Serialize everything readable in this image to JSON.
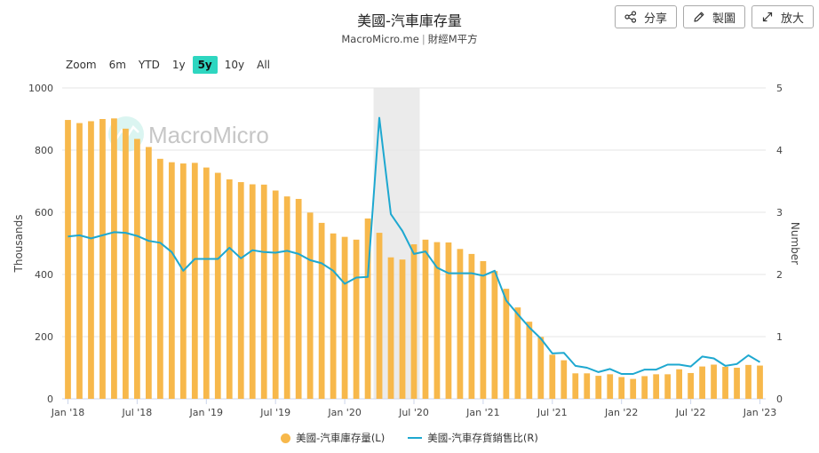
{
  "header": {
    "title": "美國-汽車庫存量",
    "source": "MacroMicro.me",
    "separator": "|",
    "source_cn": "財經M平方"
  },
  "actions": [
    {
      "label": "分享",
      "icon": "share-icon"
    },
    {
      "label": "製圖",
      "icon": "pencil-icon"
    },
    {
      "label": "放大",
      "icon": "expand-icon"
    }
  ],
  "zoom": {
    "label": "Zoom",
    "options": [
      "6m",
      "YTD",
      "1y",
      "5y",
      "10y",
      "All"
    ],
    "selected": "5y"
  },
  "watermark": "MacroMicro",
  "colors": {
    "bars": "#f7b84b",
    "line": "#1ea8d0",
    "accent": "#2ed6c0",
    "highlight": "#e6e6e6"
  },
  "chart_data": {
    "type": "bar",
    "x_ticks": [
      "Jan '18",
      "Jul '18",
      "Jan '19",
      "Jul '19",
      "Jan '20",
      "Jul '20",
      "Jan '21",
      "Jul '21",
      "Jan '22",
      "Jul '22",
      "Jan '23"
    ],
    "y_left": {
      "label": "Thousands",
      "range": [
        0,
        1000
      ],
      "ticks": [
        0,
        200,
        400,
        600,
        800,
        1000
      ]
    },
    "y_right": {
      "label": "Number",
      "range": [
        0,
        5
      ],
      "ticks": [
        0,
        1,
        2,
        3,
        4,
        5
      ]
    },
    "highlight_band": {
      "from_index": 27,
      "to_index": 31
    },
    "series": [
      {
        "name": "美國-汽車庫存量(L)",
        "type": "bar",
        "axis": "left",
        "values": [
          897,
          887,
          893,
          900,
          902,
          869,
          836,
          810,
          772,
          761,
          757,
          759,
          744,
          727,
          706,
          697,
          690,
          689,
          670,
          651,
          643,
          599,
          566,
          532,
          521,
          512,
          580,
          534,
          455,
          448,
          497,
          512,
          504,
          503,
          482,
          466,
          443,
          411,
          354,
          294,
          248,
          199,
          142,
          124,
          82,
          82,
          74,
          79,
          70,
          64,
          73,
          79,
          79,
          95,
          83,
          104,
          110,
          103,
          100,
          109,
          107
        ]
      },
      {
        "name": "美國-汽車存貨銷售比(R)",
        "type": "line",
        "axis": "right",
        "values": [
          2.61,
          2.63,
          2.58,
          2.63,
          2.68,
          2.67,
          2.62,
          2.54,
          2.51,
          2.36,
          2.06,
          2.25,
          2.25,
          2.25,
          2.43,
          2.26,
          2.39,
          2.36,
          2.35,
          2.38,
          2.33,
          2.23,
          2.18,
          2.06,
          1.85,
          1.95,
          1.96,
          4.52,
          2.97,
          2.7,
          2.33,
          2.37,
          2.11,
          2.02,
          2.02,
          2.02,
          1.98,
          2.06,
          1.58,
          1.36,
          1.15,
          0.97,
          0.73,
          0.74,
          0.53,
          0.5,
          0.43,
          0.48,
          0.4,
          0.4,
          0.47,
          0.47,
          0.55,
          0.55,
          0.52,
          0.68,
          0.65,
          0.53,
          0.56,
          0.7,
          0.59
        ]
      }
    ]
  }
}
